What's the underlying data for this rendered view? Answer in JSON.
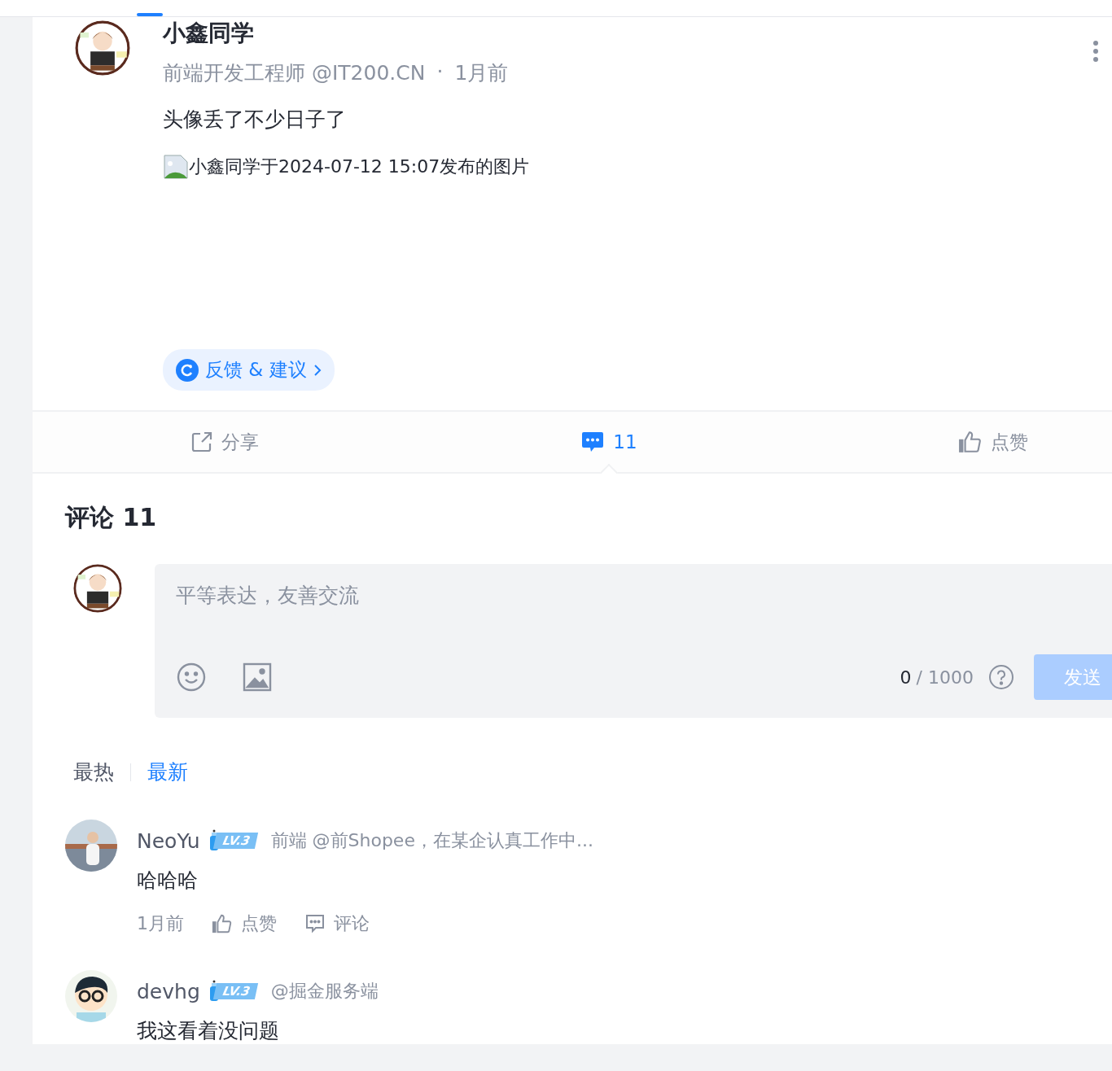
{
  "post": {
    "author": "小鑫同学",
    "subtitle": "前端开发工程师 @IT200.CN",
    "separator": "·",
    "time": "1月前",
    "text": "头像丢了不少日子了",
    "image_alt": "小鑫同学于2024-07-12 15:07发布的图片",
    "feedback": "反馈 & 建议"
  },
  "actions": [
    {
      "kind": "share",
      "label": "分享",
      "selected": false
    },
    {
      "kind": "comment",
      "label": "11",
      "selected": true
    },
    {
      "kind": "like",
      "label": "点赞",
      "selected": false
    }
  ],
  "comments_section": {
    "title": "评论 11",
    "editor": {
      "placeholder": "平等表达，友善交流",
      "counter_value": "0",
      "counter_limit": "/ 1000",
      "send": "发送",
      "disabled": true
    },
    "sort_tabs": [
      {
        "label": "最热",
        "selected": false
      },
      {
        "label": "最新",
        "selected": true
      }
    ],
    "comments": [
      {
        "name": "NeoYu",
        "level": "LV.3",
        "bio": "前端 @前Shopee，在某企认真工作中...",
        "text": "哈哈哈",
        "time": "1月前",
        "like": "点赞",
        "reply": "评论"
      },
      {
        "name": "devhg",
        "level": "LV.3",
        "bio": "@掘金服务端",
        "text": "我这看着没问题"
      }
    ]
  }
}
